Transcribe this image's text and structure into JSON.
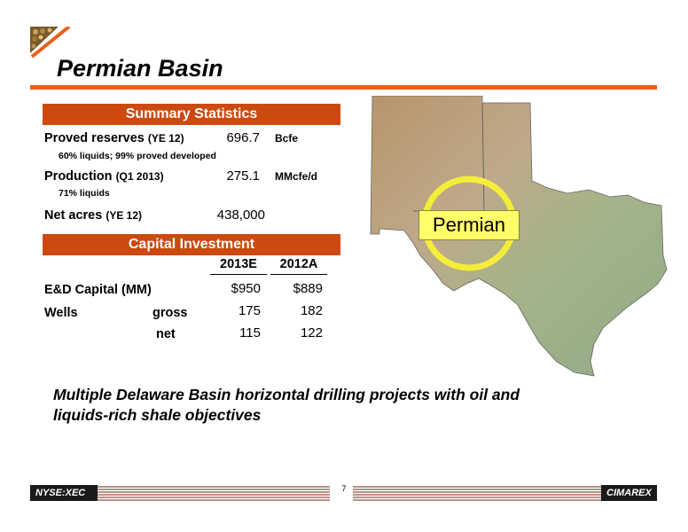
{
  "header": {
    "title": "Permian Basin"
  },
  "summary": {
    "heading": "Summary Statistics",
    "rows": [
      {
        "label": "Proved reserves",
        "qualifier": "(YE 12)",
        "value": "696.7",
        "unit": "Bcfe",
        "note": "60% liquids;  99% proved developed"
      },
      {
        "label": "Production",
        "qualifier": "(Q1 2013)",
        "value": "275.1",
        "unit": "MMcfe/d",
        "note": "71% liquids"
      },
      {
        "label": "Net acres",
        "qualifier": "(YE 12)",
        "value": "438,000",
        "unit": "",
        "note": ""
      }
    ]
  },
  "capital": {
    "heading": "Capital Investment",
    "columns": [
      "2013E",
      "2012A"
    ],
    "rows": [
      {
        "label": "E&D Capital (MM)",
        "sublabel": "",
        "values": [
          "$950",
          "$889"
        ]
      },
      {
        "label": "Wells",
        "sublabel": "gross",
        "values": [
          "175",
          "182"
        ]
      },
      {
        "label": "",
        "sublabel": "net",
        "values": [
          "115",
          "122"
        ]
      }
    ]
  },
  "map": {
    "callout": "Permian"
  },
  "tagline": "Multiple Delaware Basin horizontal drilling projects with oil and liquids-rich shale objectives",
  "footer": {
    "ticker": "NYSE:XEC",
    "page": "7",
    "brand": "CIMAREX"
  },
  "colors": {
    "accent": "#e8601a",
    "banner": "#cc4a10",
    "callout": "#fffd6a"
  }
}
